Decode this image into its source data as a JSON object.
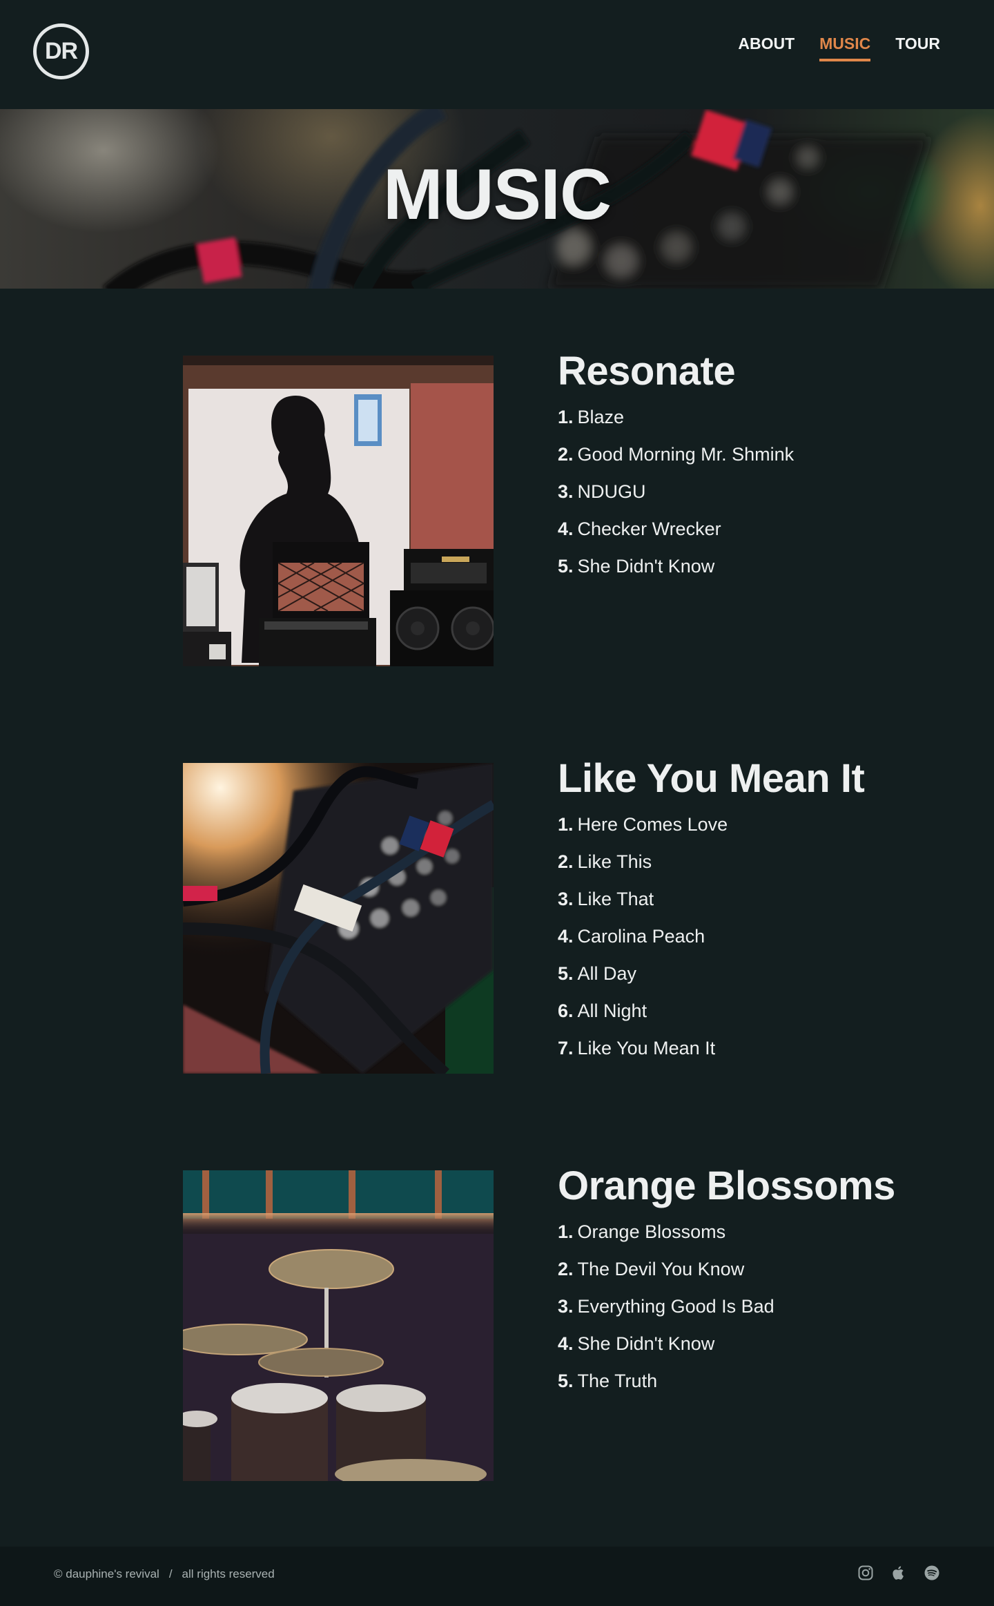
{
  "header": {
    "logo_text": "DR",
    "nav": [
      {
        "label": "ABOUT",
        "active": false
      },
      {
        "label": "MUSIC",
        "active": true
      },
      {
        "label": "TOUR",
        "active": false
      }
    ]
  },
  "hero": {
    "title": "MUSIC"
  },
  "albums": [
    {
      "title": "Resonate",
      "cover_image": "studio poster with amplifiers",
      "tracks": [
        {
          "num": "1.",
          "name": "Blaze"
        },
        {
          "num": "2.",
          "name": "Good Morning Mr. Shmink"
        },
        {
          "num": "3.",
          "name": "NDUGU"
        },
        {
          "num": "4.",
          "name": "Checker Wrecker"
        },
        {
          "num": "5.",
          "name": "She Didn't Know"
        }
      ]
    },
    {
      "title": "Like You Mean It",
      "cover_image": "patch bay with cables",
      "tracks": [
        {
          "num": "1.",
          "name": "Here Comes Love"
        },
        {
          "num": "2.",
          "name": "Like This"
        },
        {
          "num": "3.",
          "name": "Like That"
        },
        {
          "num": "4.",
          "name": "Carolina Peach"
        },
        {
          "num": "5.",
          "name": "All Day"
        },
        {
          "num": "6.",
          "name": "All Night"
        },
        {
          "num": "7.",
          "name": "Like You Mean It"
        }
      ]
    },
    {
      "title": "Orange Blossoms",
      "cover_image": "drum kit in studio",
      "tracks": [
        {
          "num": "1.",
          "name": "Orange Blossoms"
        },
        {
          "num": "2.",
          "name": "The Devil You Know"
        },
        {
          "num": "3.",
          "name": "Everything Good Is Bad"
        },
        {
          "num": "4.",
          "name": "She Didn't Know"
        },
        {
          "num": "5.",
          "name": "The Truth"
        }
      ]
    }
  ],
  "footer": {
    "copyright": "© dauphine's revival",
    "separator": "/",
    "rights": "all rights reserved",
    "socials": [
      "instagram-icon",
      "apple-icon",
      "spotify-icon"
    ]
  },
  "colors": {
    "background": "#131e1f",
    "footer": "#0e1718",
    "accent": "#e0874a",
    "text": "#eef0f0"
  }
}
